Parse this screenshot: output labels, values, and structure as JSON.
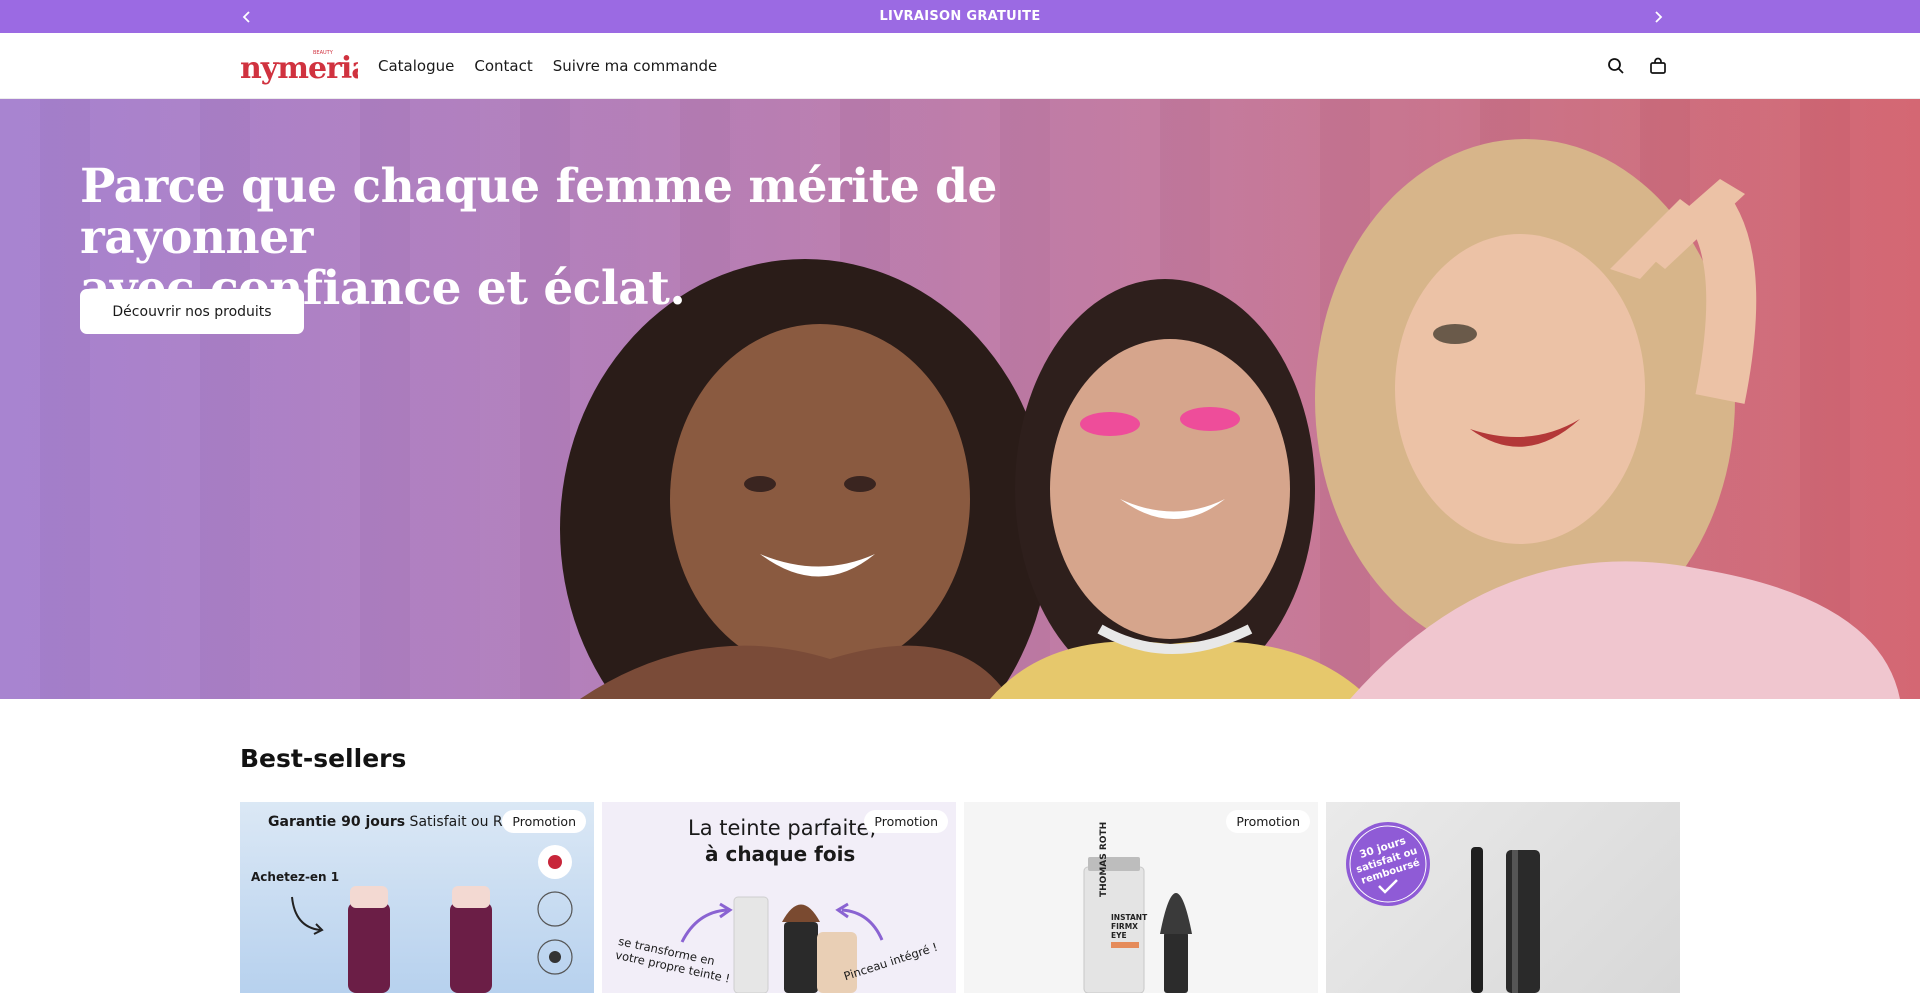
{
  "announcement": {
    "text": "LIVRAISON GRATUITE",
    "prev_icon": "chevron-left-icon",
    "next_icon": "chevron-right-icon"
  },
  "header": {
    "logo_text": "nymeria",
    "logo_tagline": "BEAUTY",
    "nav": [
      "Catalogue",
      "Contact",
      "Suivre ma commande"
    ],
    "search_icon": "search-icon",
    "cart_icon": "cart-icon"
  },
  "hero": {
    "title_line1": "Parce que chaque femme mérite de rayonner",
    "title_line2": "avec confiance et éclat.",
    "cta": "Découvrir nos produits"
  },
  "bestsellers": {
    "title": "Best-sellers",
    "products": [
      {
        "badge": "Promotion",
        "headline_bold": "Garantie 90 jours",
        "headline_rest": " Satisfait ou Re",
        "note": "Achetez-en 1"
      },
      {
        "badge": "Promotion",
        "headline_line1": "La teinte parfaite,",
        "headline_line2": "à chaque fois",
        "note_left_line1": "se transforme en",
        "note_left_line2": "votre propre teinte !",
        "note_right": "Pinceau intégré !"
      },
      {
        "badge": "Promotion",
        "brand": "THOMAS ROTH",
        "product_line1": "INSTANT",
        "product_line2": "FIRMX",
        "product_line3": "EYE"
      },
      {
        "badge": "",
        "seal_line1": "30 jours",
        "seal_line2": "satisfait ou",
        "seal_line3": "remboursé"
      }
    ]
  },
  "colors": {
    "announcement_bg": "#9b6ae3",
    "logo_red": "#d0323f",
    "hero_left": "#a580cf",
    "hero_right": "#d36470"
  }
}
